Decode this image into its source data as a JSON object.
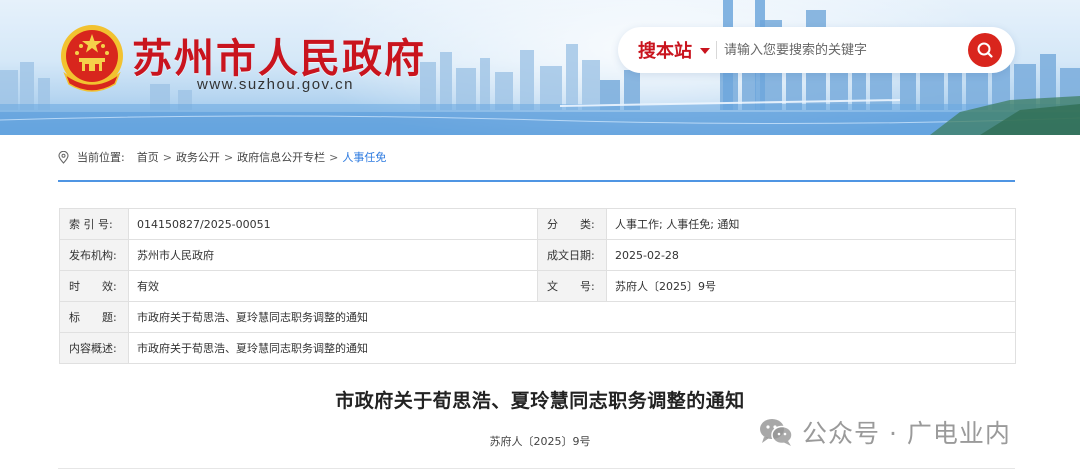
{
  "header": {
    "site_title": "苏州市人民政府",
    "site_url": "www.suzhou.gov.cn",
    "emblem_icon": "national-emblem-icon"
  },
  "search": {
    "scope_label": "搜本站",
    "placeholder": "请输入您要搜索的关键字",
    "button_icon": "search-icon"
  },
  "breadcrumb": {
    "label": "当前位置:",
    "items": [
      "首页",
      "政务公开",
      "政府信息公开专栏"
    ],
    "current": "人事任免",
    "separator": ">"
  },
  "info": {
    "index_label": "索 引 号:",
    "index_value": "014150827/2025-00051",
    "category_label": "分　　类:",
    "category_value": "人事工作;  人事任免;  通知",
    "publisher_label": "发布机构:",
    "publisher_value": "苏州市人民政府",
    "date_label": "成文日期:",
    "date_value": "2025-02-28",
    "validity_label": "时　　效:",
    "validity_value": "有效",
    "docno_label": "文　　号:",
    "docno_value": "苏府人〔2025〕9号",
    "title_label": "标　　题:",
    "title_value": "市政府关于荀思浩、夏玲慧同志职务调整的通知",
    "summary_label": "内容概述:",
    "summary_value": "市政府关于荀思浩、夏玲慧同志职务调整的通知"
  },
  "article": {
    "title": "市政府关于荀思浩、夏玲慧同志职务调整的通知",
    "doc_number": "苏府人〔2025〕9号"
  },
  "watermark": {
    "text": "公众号 · 广电业内",
    "icon": "wechat-icon"
  },
  "colors": {
    "brand_red": "#c9141e",
    "search_button": "#d9251d",
    "accent_blue": "#4f95e3",
    "breadcrumb_current": "#2e7be0"
  }
}
